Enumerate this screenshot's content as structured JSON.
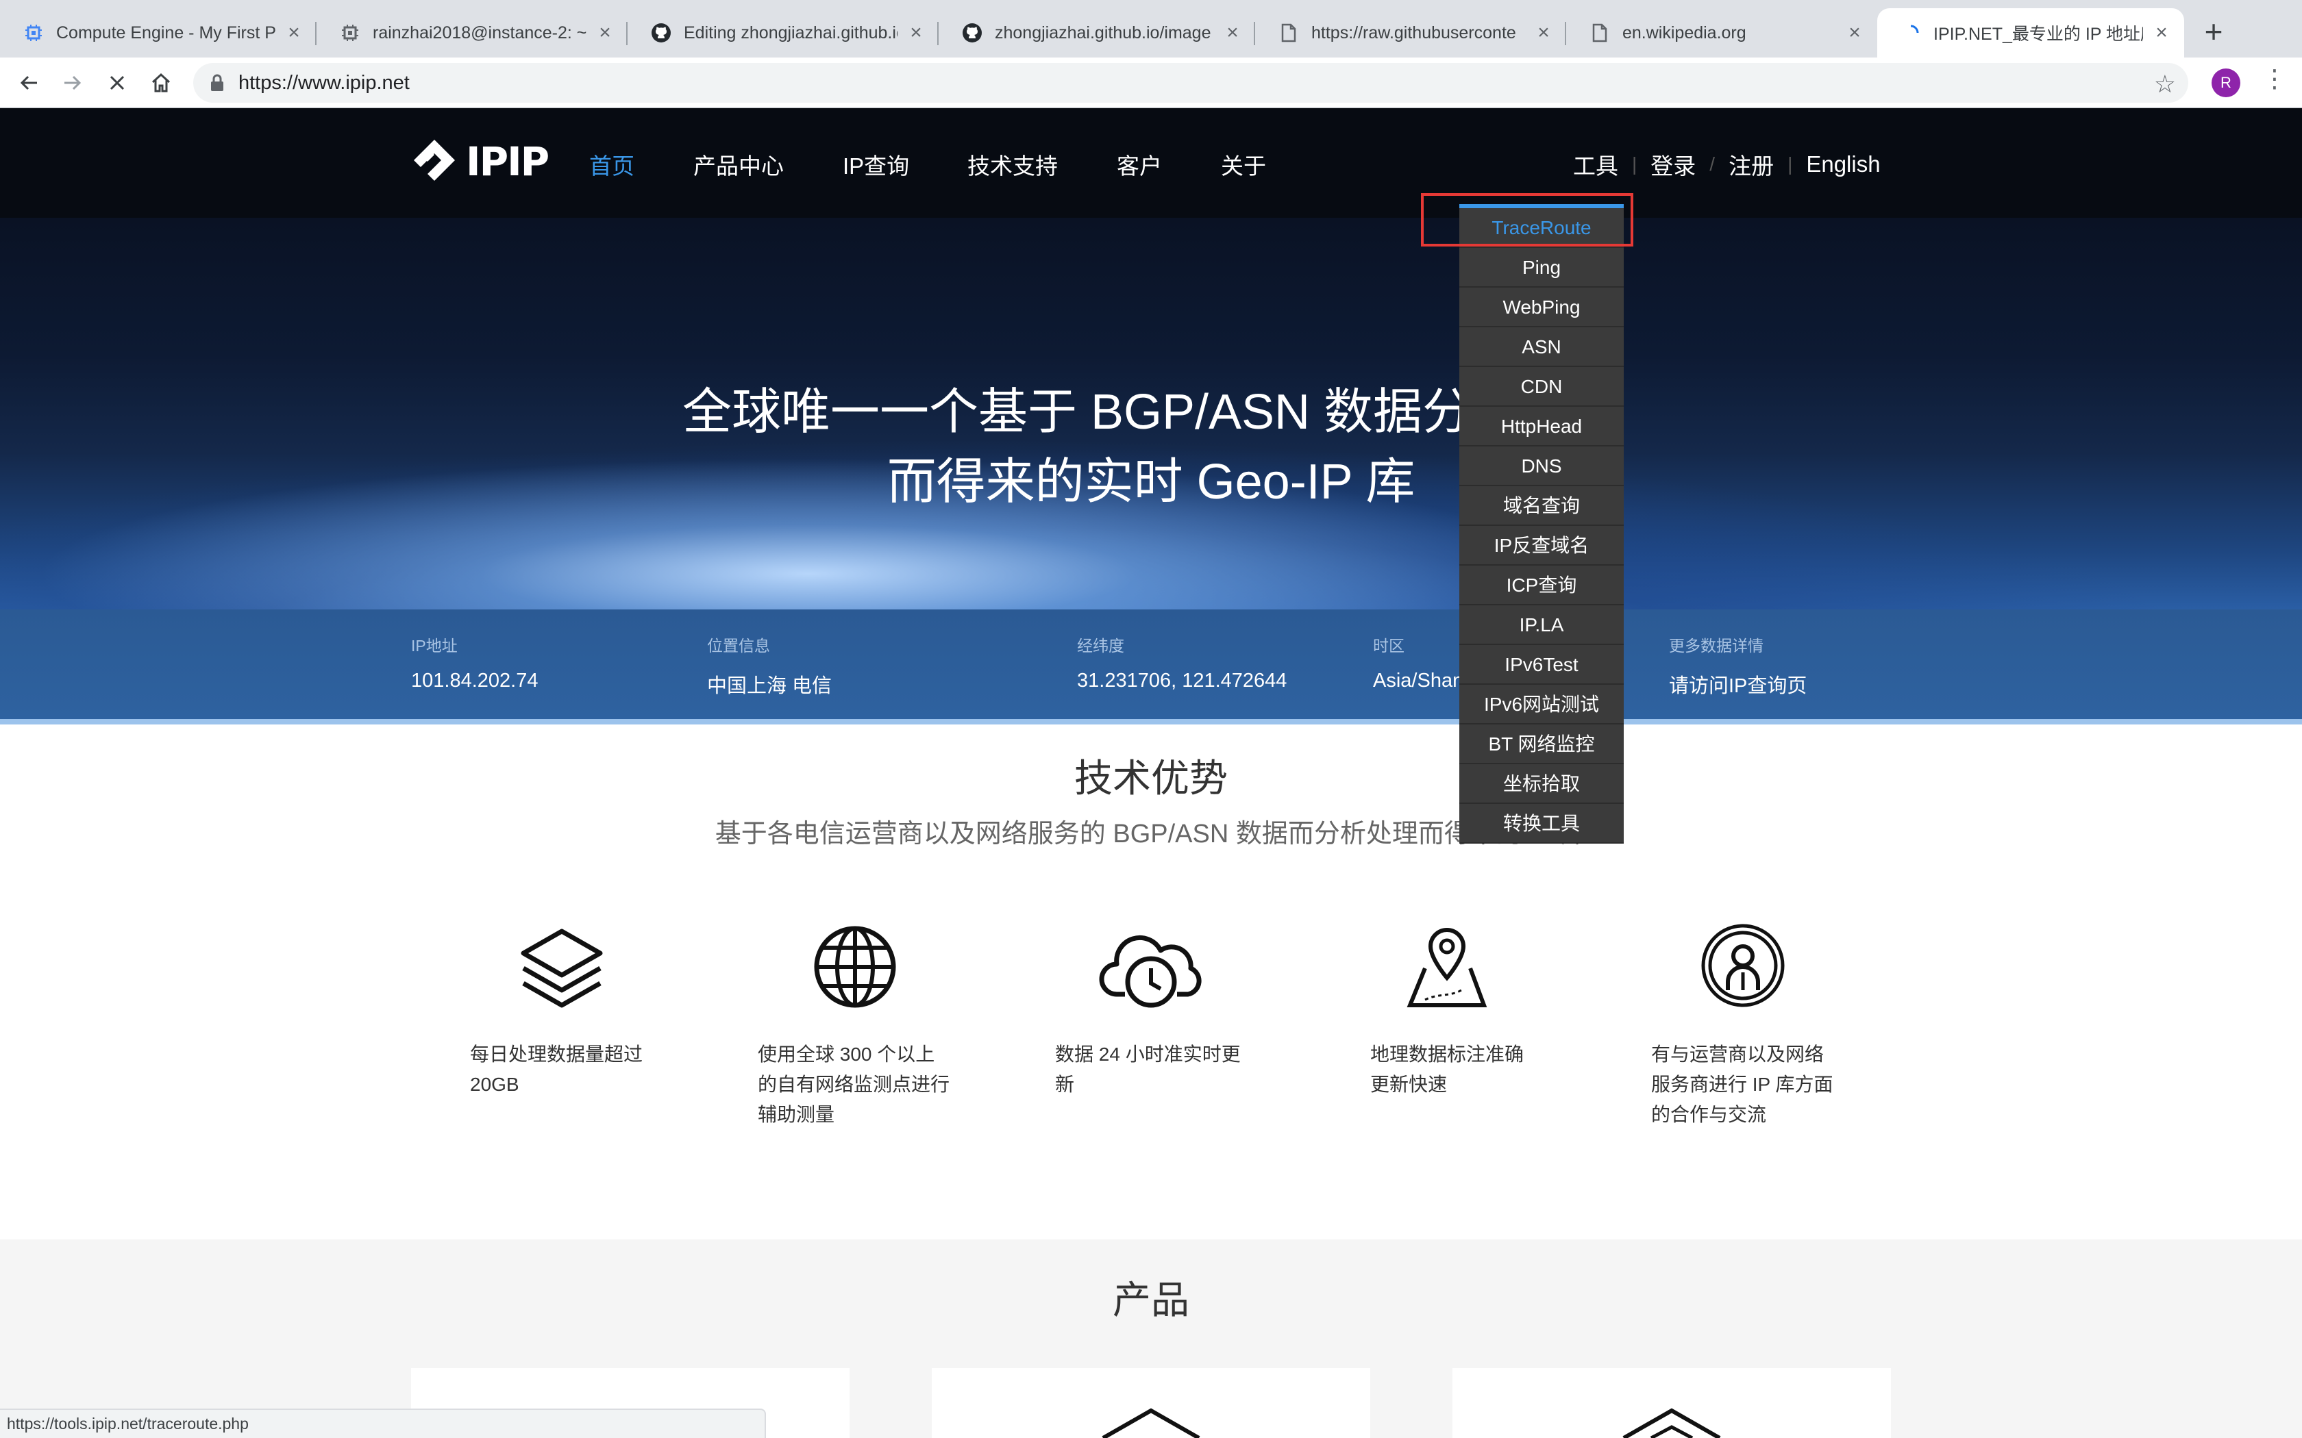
{
  "browser": {
    "tabs": [
      {
        "title": "Compute Engine - My First P",
        "icon": "compute-engine-icon"
      },
      {
        "title": "rainzhai2018@instance-2: ~",
        "icon": "terminal-chip-icon"
      },
      {
        "title": "Editing zhongjiazhai.github.io",
        "icon": "github-icon"
      },
      {
        "title": "zhongjiazhai.github.io/image",
        "icon": "github-icon"
      },
      {
        "title": "https://raw.githubuserconte",
        "icon": "document-icon"
      },
      {
        "title": "en.wikipedia.org",
        "icon": "document-icon"
      },
      {
        "title": "IPIP.NET_最专业的 IP 地址库",
        "icon": "loading-icon",
        "active": true
      }
    ],
    "url": "https://www.ipip.net",
    "profile_initial": "R",
    "status_url": "https://tools.ipip.net/traceroute.php"
  },
  "site": {
    "logo_text": "IPIP",
    "nav": [
      "首页",
      "产品中心",
      "IP查询",
      "技术支持",
      "客户",
      "关于"
    ],
    "right_nav": [
      "工具",
      "登录",
      "注册",
      "English"
    ],
    "hero_line1": "全球唯一一个基于 BGP/ASN 数据分析处理",
    "hero_line2": "而得来的实时 Geo-IP 库",
    "info": [
      {
        "label": "IP地址",
        "value": "101.84.202.74"
      },
      {
        "label": "位置信息",
        "value": "中国上海 电信"
      },
      {
        "label": "经纬度",
        "value": "31.231706, 121.472644"
      },
      {
        "label": "时区",
        "value": "Asia/Shanghai"
      },
      {
        "label": "更多数据详情",
        "value": "请访问IP查询页"
      }
    ],
    "section1_title": "技术优势",
    "section1_subtitle": "基于各电信运营商以及网络服务的 BGP/ASN 数据而分析处理而得来的 IP 库",
    "features": [
      {
        "icon": "layers-icon",
        "lines": [
          "每日处理数据量超过",
          "20GB"
        ]
      },
      {
        "icon": "globe-icon",
        "lines": [
          "使用全球 300 个以上",
          "的自有网络监测点进行",
          "辅助测量"
        ]
      },
      {
        "icon": "cloud-clock-icon",
        "lines": [
          "数据 24 小时准实时更",
          "新"
        ]
      },
      {
        "icon": "map-pin-icon",
        "lines": [
          "地理数据标注准确",
          "更新快速"
        ]
      },
      {
        "icon": "user-circle-icon",
        "lines": [
          "有与运营商以及网络",
          "服务商进行 IP 库方面",
          "的合作与交流"
        ]
      }
    ],
    "products_title": "产品",
    "tools_menu": [
      "TraceRoute",
      "Ping",
      "WebPing",
      "ASN",
      "CDN",
      "HttpHead",
      "DNS",
      "域名查询",
      "IP反查域名",
      "ICP查询",
      "IP.LA",
      "IPv6Test",
      "IPv6网站测试",
      "BT 网络监控",
      "坐标拾取",
      "转换工具"
    ],
    "tools_menu_selected": 0
  },
  "colors": {
    "accent_blue": "#3a97e8",
    "header_bg": "#070b12",
    "highlight_red": "#e53935",
    "dropdown_bg": "#3b3b3b"
  }
}
